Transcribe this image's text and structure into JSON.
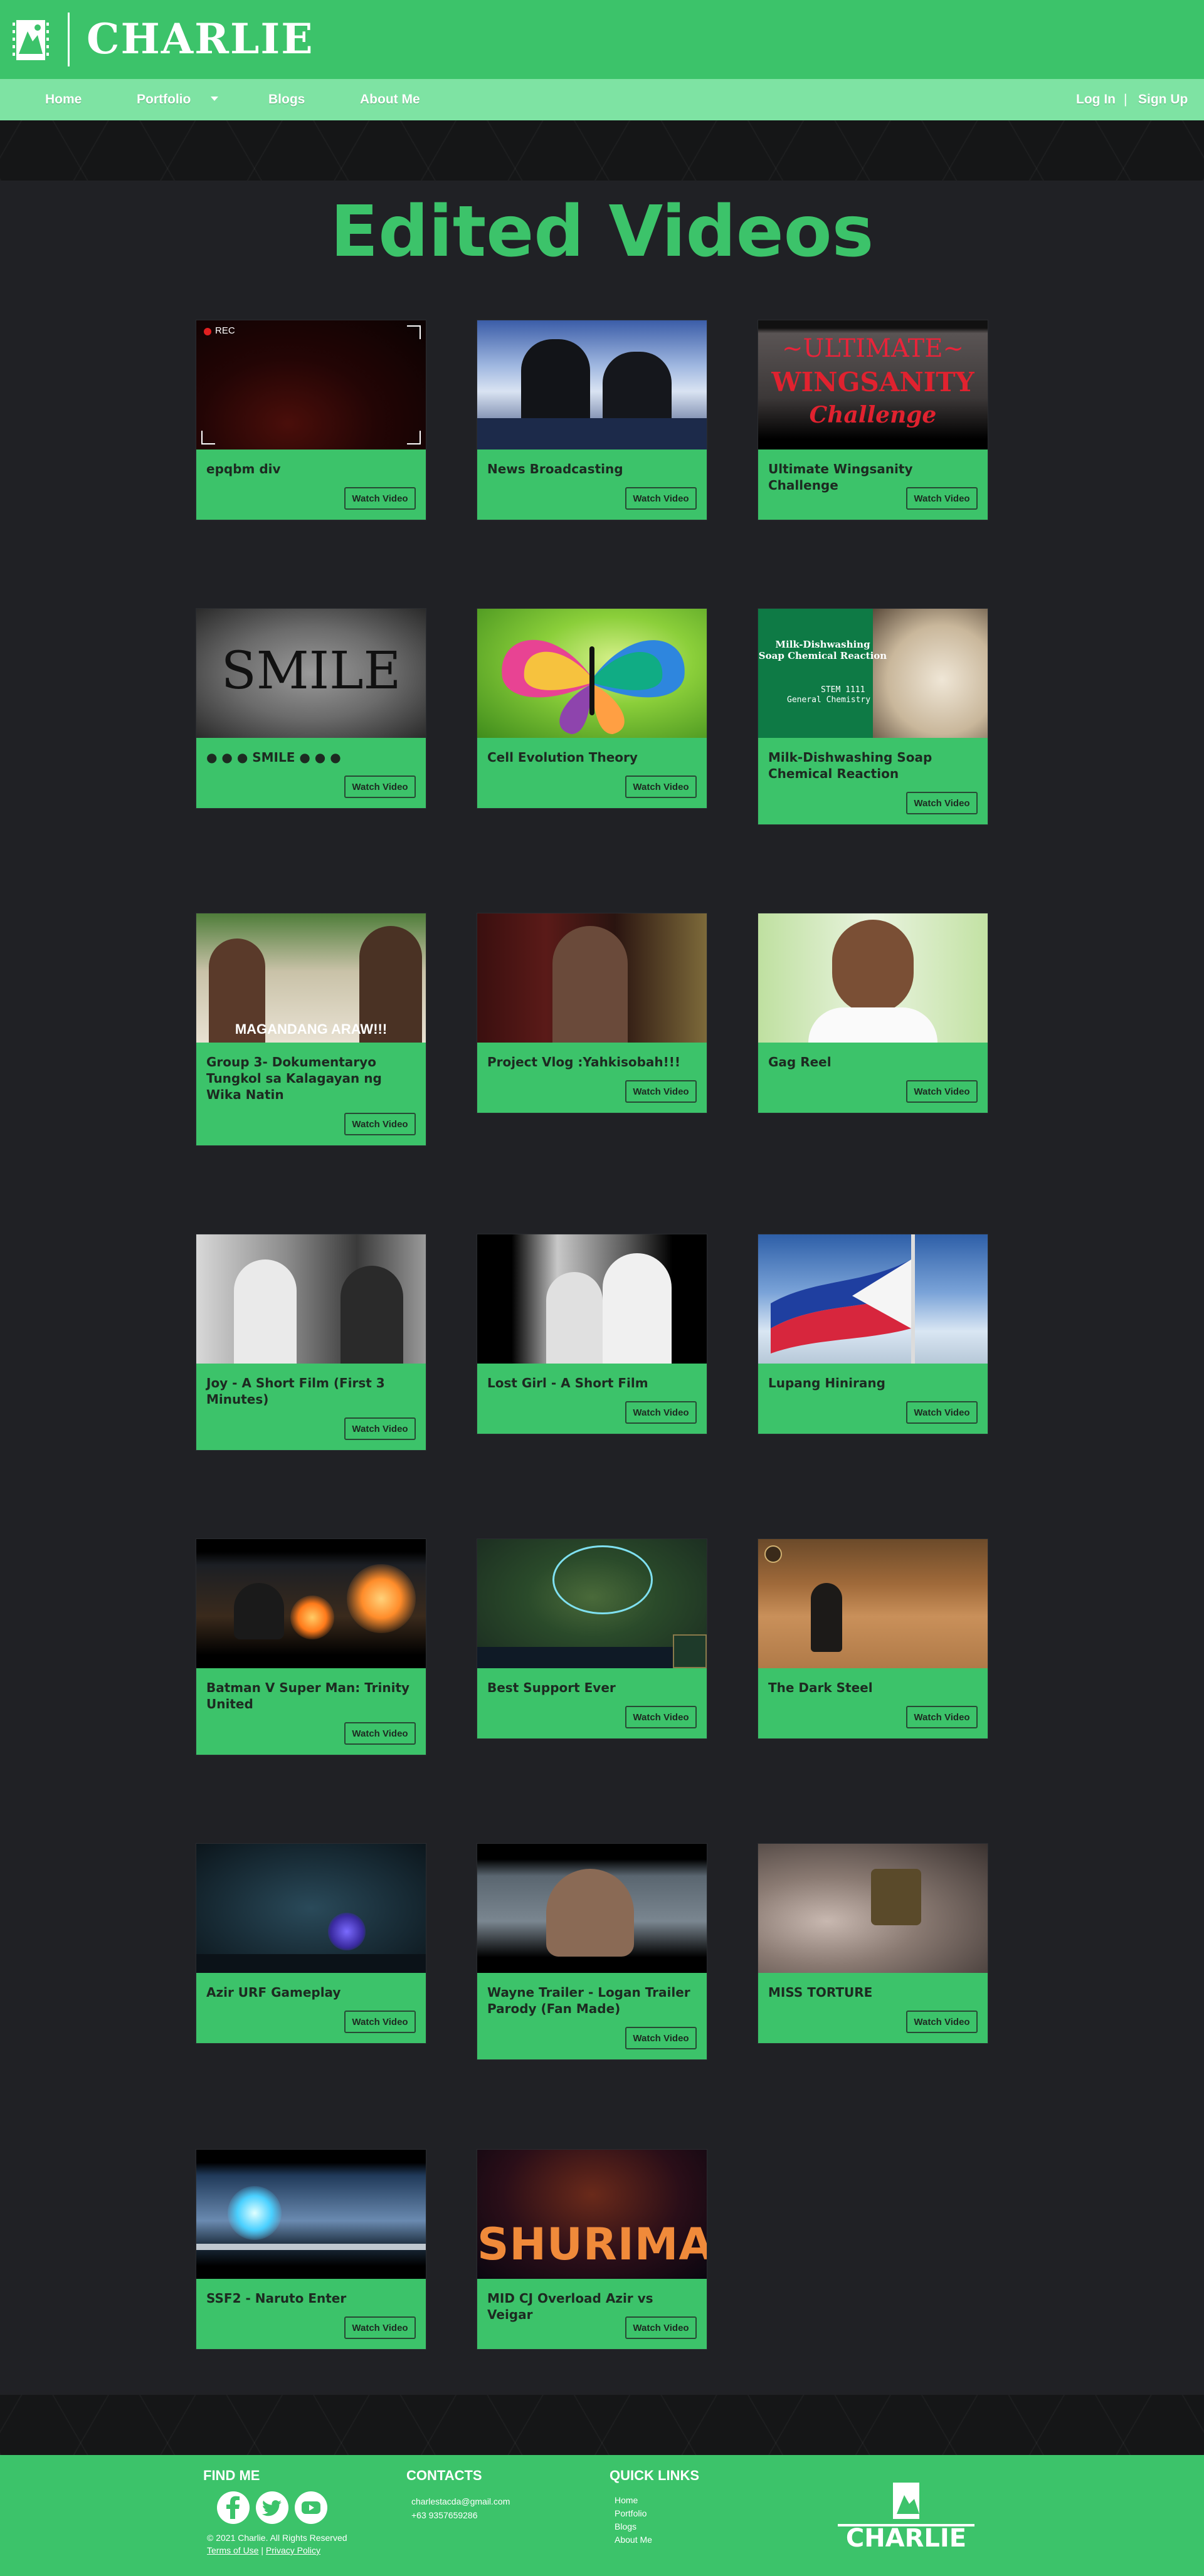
{
  "header": {
    "brand": "CHARLIE",
    "nav": {
      "home": "Home",
      "portfolio": "Portfolio",
      "blogs": "Blogs",
      "about": "About Me",
      "login": "Log In",
      "separator": "|",
      "signup": "Sign Up"
    }
  },
  "main": {
    "heading": "Edited Videos",
    "watch_label": "Watch Video",
    "videos": [
      {
        "title": "epqbm div"
      },
      {
        "title": "News Broadcasting"
      },
      {
        "title": "Ultimate Wingsanity Challenge"
      },
      {
        "title": "● ● ● SMILE ● ● ●"
      },
      {
        "title": "Cell Evolution Theory"
      },
      {
        "title": "Milk-Dishwashing Soap Chemical Reaction"
      },
      {
        "title": "Group 3- Dokumentaryo Tungkol sa Kalagayan ng Wika Natin"
      },
      {
        "title": "Project Vlog :Yahkisobah!!!"
      },
      {
        "title": "Gag Reel"
      },
      {
        "title": "Joy - A Short Film (First 3 Minutes)"
      },
      {
        "title": "Lost Girl - A Short Film"
      },
      {
        "title": "Lupang Hinirang"
      },
      {
        "title": "Batman V Super Man: Trinity United"
      },
      {
        "title": "Best Support Ever"
      },
      {
        "title": "The Dark Steel"
      },
      {
        "title": "Azir URF Gameplay"
      },
      {
        "title": "Wayne Trailer - Logan Trailer Parody (Fan Made)"
      },
      {
        "title": "MISS TORTURE"
      },
      {
        "title": "SSF2 - Naruto Enter"
      },
      {
        "title": "MID CJ Overload Azir vs Veigar"
      }
    ],
    "thumb_text": {
      "rec": "REC",
      "ultimate": "~ULTIMATE~",
      "wingsanity": "WINGSANITY",
      "challenge": "Challenge",
      "smile": "SMILE",
      "milk_line1": "Milk-Dishwashing",
      "milk_line2": "Soap Chemical Reaction",
      "stem": "STEM 1111",
      "chem": "General Chemistry",
      "magandang": "MAGANDANG ARAW!!!",
      "shurima": "SHURIMA"
    }
  },
  "footer": {
    "find_me": "FIND ME",
    "copyright": "© 2021 Charlie. All Rights Reserved",
    "terms": "Terms of Use",
    "pipe": "|",
    "privacy": "Privacy Policy",
    "contacts": "CONTACTS",
    "email": "charlestacda@gmail.com",
    "phone": "+63 9357659286",
    "quick_links": "QUICK LINKS",
    "links": [
      "Home",
      "Portfolio",
      "Blogs",
      "About Me"
    ],
    "brand": "CHARLIE"
  },
  "colors": {
    "accent": "#3cc36a",
    "nav": "#7ee3a3",
    "background": "#202125",
    "band": "#151617"
  },
  "icons": [
    "film-logo-icon",
    "facebook-icon",
    "twitter-icon",
    "youtube-icon",
    "caret-down-icon"
  ]
}
